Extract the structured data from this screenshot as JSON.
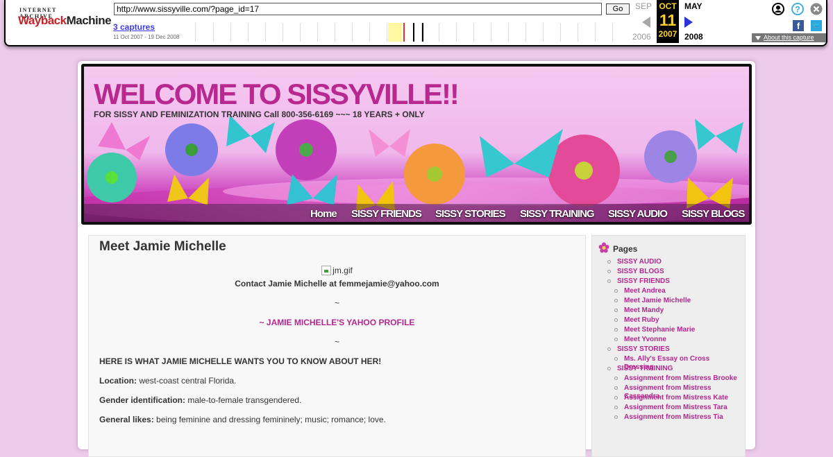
{
  "wayback": {
    "logo_top": "INTERNET ARCHIVE",
    "logo_w": "Wayback",
    "logo_m": "Machine",
    "url_value": "http://www.sissyville.com/?page_id=17",
    "go_label": "Go",
    "captures_link": "3 captures",
    "capture_range": "11 Oct 2007 - 19 Dec 2008",
    "prev_month": "SEP",
    "cur_month": "OCT",
    "cur_day": "11",
    "cur_year": "2007",
    "next_month": "MAY",
    "prev_year": "2006",
    "next_year": "2008",
    "about_label": "About this capture"
  },
  "site": {
    "title": "WELCOME TO SISSYVILLE!!",
    "description": "FOR SISSY AND FEMINIZATION TRAINING Call 800-356-6169 ~~~ 18 YEARS + ONLY",
    "nav": [
      "Home",
      "SISSY FRIENDS",
      "SISSY STORIES",
      "SISSY TRAINING",
      "SISSY AUDIO",
      "SISSY BLOGS"
    ]
  },
  "post": {
    "title": "Meet Jamie Michelle",
    "image_alt": "jm.gif",
    "contact": "Contact Jamie Michelle at femmejamie@yahoo.com",
    "tilde1": "~",
    "profile_link": "~ JAMIE MICHELLE'S YAHOO PROFILE",
    "tilde2": "~",
    "intro": "HERE IS WHAT JAMIE MICHELLE WANTS YOU TO KNOW ABOUT HER!",
    "location_label": "Location:",
    "location_value": " west-coast central Florida.",
    "gender_label": "Gender identification:",
    "gender_value": " male-to-female transgendered.",
    "likes_label": "General likes:",
    "likes_value": " being feminine and dressing femininely; music; romance; love."
  },
  "sidebar": {
    "heading": "Pages",
    "items": [
      {
        "label": "SISSY AUDIO",
        "level": 0
      },
      {
        "label": "SISSY BLOGS",
        "level": 0
      },
      {
        "label": "SISSY FRIENDS",
        "level": 0
      },
      {
        "label": "Meet Andrea",
        "level": 1
      },
      {
        "label": "Meet Jamie Michelle",
        "level": 1
      },
      {
        "label": "Meet Mandy",
        "level": 1
      },
      {
        "label": "Meet Ruby",
        "level": 1
      },
      {
        "label": "Meet Stephanie Marie",
        "level": 1
      },
      {
        "label": "Meet Yvonne",
        "level": 1
      },
      {
        "label": "SISSY STORIES",
        "level": 0
      },
      {
        "label": "Ms. Ally's Essay on Cross Dressing",
        "level": 1
      },
      {
        "label": "SISSY TRAINING",
        "level": 0
      },
      {
        "label": "Assignment from Mistress Brooke",
        "level": 1
      },
      {
        "label": "Assignment from Mistress Cassandra",
        "level": 1
      },
      {
        "label": "Assignment from Mistress Kate",
        "level": 1
      },
      {
        "label": "Assignment from Mistress Tara",
        "level": 1
      },
      {
        "label": "Assignment from Mistress Tia",
        "level": 1
      }
    ]
  },
  "colors": {
    "page_bg": "#eccbea",
    "accent_pink": "#b3278f",
    "wayback_red": "#c5232a",
    "wayback_blue": "#2c35d8"
  }
}
